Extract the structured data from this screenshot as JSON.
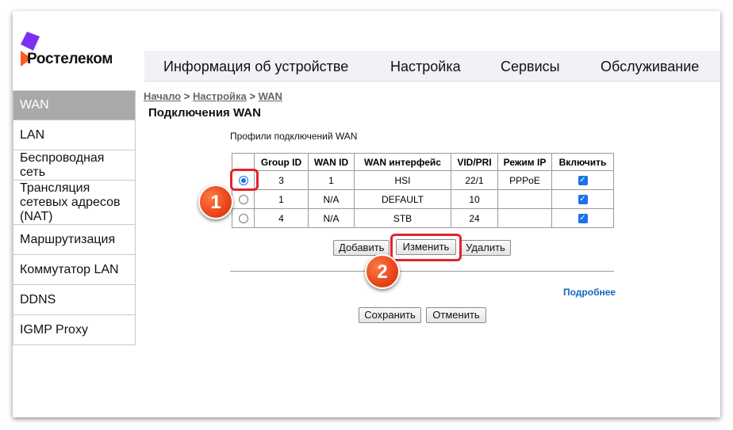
{
  "brand": {
    "name": "Ростелеком",
    "colors": {
      "purple": "#7b2ff2",
      "orange": "#ff5a1f"
    }
  },
  "topnav": [
    "Информация об устройстве",
    "Настройка",
    "Сервисы",
    "Обслуживание"
  ],
  "sidebar": [
    {
      "label": "WAN",
      "active": true
    },
    {
      "label": "LAN"
    },
    {
      "label": "Беспроводная сеть"
    },
    {
      "label": "Трансляция сетевых адресов (NAT)"
    },
    {
      "label": "Маршрутизация"
    },
    {
      "label": "Коммутатор LAN"
    },
    {
      "label": "DDNS"
    },
    {
      "label": "IGMP Proxy"
    }
  ],
  "breadcrumb": {
    "home": "Начало",
    "section": "Настройка",
    "page": "WAN",
    "sep": " > "
  },
  "page_title": "Подключения WAN",
  "subtitle": "Профили подключений WAN",
  "table": {
    "headers": [
      "",
      "Group ID",
      "WAN ID",
      "WAN интерфейс",
      "VID/PRI",
      "Режим IP",
      "Включить"
    ],
    "rows": [
      {
        "selected": true,
        "group_id": "3",
        "wan_id": "1",
        "iface": "HSI",
        "vid": "22/1",
        "ip_mode": "PPPoE",
        "enabled": true
      },
      {
        "selected": false,
        "group_id": "1",
        "wan_id": "N/A",
        "iface": "DEFAULT",
        "vid": "10",
        "ip_mode": "",
        "enabled": true
      },
      {
        "selected": false,
        "group_id": "4",
        "wan_id": "N/A",
        "iface": "STB",
        "vid": "24",
        "ip_mode": "",
        "enabled": true
      }
    ]
  },
  "buttons": {
    "add": "Добавить",
    "edit": "Изменить",
    "delete": "Удалить",
    "save": "Сохранить",
    "cancel": "Отменить"
  },
  "more_link": "Подробнее",
  "annotations": {
    "step1": "1",
    "step2": "2",
    "highlight_color": "#e0242e"
  }
}
